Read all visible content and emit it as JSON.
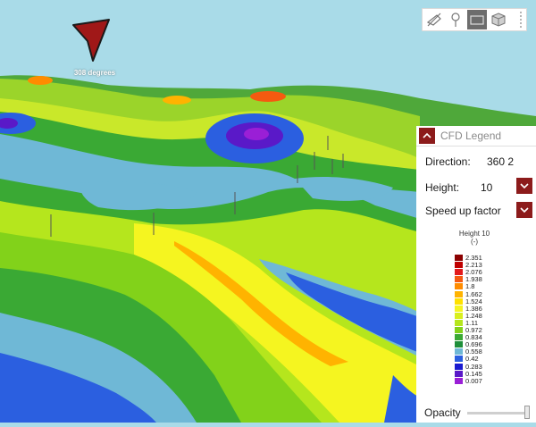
{
  "view": {
    "direction_label": "308 degrees",
    "compass_icon": "navigation-arrow-icon",
    "compass_color": "#a01818",
    "sky_color": "#a9dbe8"
  },
  "toolbar": {
    "tools": [
      {
        "name": "hide-layer-icon",
        "active": false
      },
      {
        "name": "map-pin-icon",
        "active": false
      },
      {
        "name": "flat-map-icon",
        "active": true
      },
      {
        "name": "3d-box-icon",
        "active": false
      }
    ]
  },
  "legend_panel": {
    "title": "CFD Legend",
    "direction_label": "Direction:",
    "direction_value": "360 2",
    "height_label": "Height:",
    "height_value": "10",
    "layer_label": "Speed up factor",
    "scale_title_line1": "Height 10",
    "scale_title_line2": "(-)",
    "accent_color": "#8c1b1b",
    "entries": [
      {
        "value": "2.351",
        "color": "#8b0000"
      },
      {
        "value": "2.213",
        "color": "#c00000"
      },
      {
        "value": "2.076",
        "color": "#e31a1c"
      },
      {
        "value": "1.938",
        "color": "#f55a10"
      },
      {
        "value": "1.8",
        "color": "#ff8c00"
      },
      {
        "value": "1.662",
        "color": "#ffb300"
      },
      {
        "value": "1.524",
        "color": "#ffe100"
      },
      {
        "value": "1.386",
        "color": "#f5f520"
      },
      {
        "value": "1.248",
        "color": "#d8ef1e"
      },
      {
        "value": "1.11",
        "color": "#b5e61d"
      },
      {
        "value": "0.972",
        "color": "#82d21a"
      },
      {
        "value": "0.834",
        "color": "#3aa934"
      },
      {
        "value": "0.696",
        "color": "#1f8f3a"
      },
      {
        "value": "0.558",
        "color": "#6fb8d6"
      },
      {
        "value": "0.42",
        "color": "#2b5fe0"
      },
      {
        "value": "0.283",
        "color": "#1a1ad0"
      },
      {
        "value": "0.145",
        "color": "#5a19c8"
      },
      {
        "value": "0.007",
        "color": "#9a1fd6"
      }
    ],
    "opacity_label": "Opacity",
    "opacity_value": 0.95
  }
}
